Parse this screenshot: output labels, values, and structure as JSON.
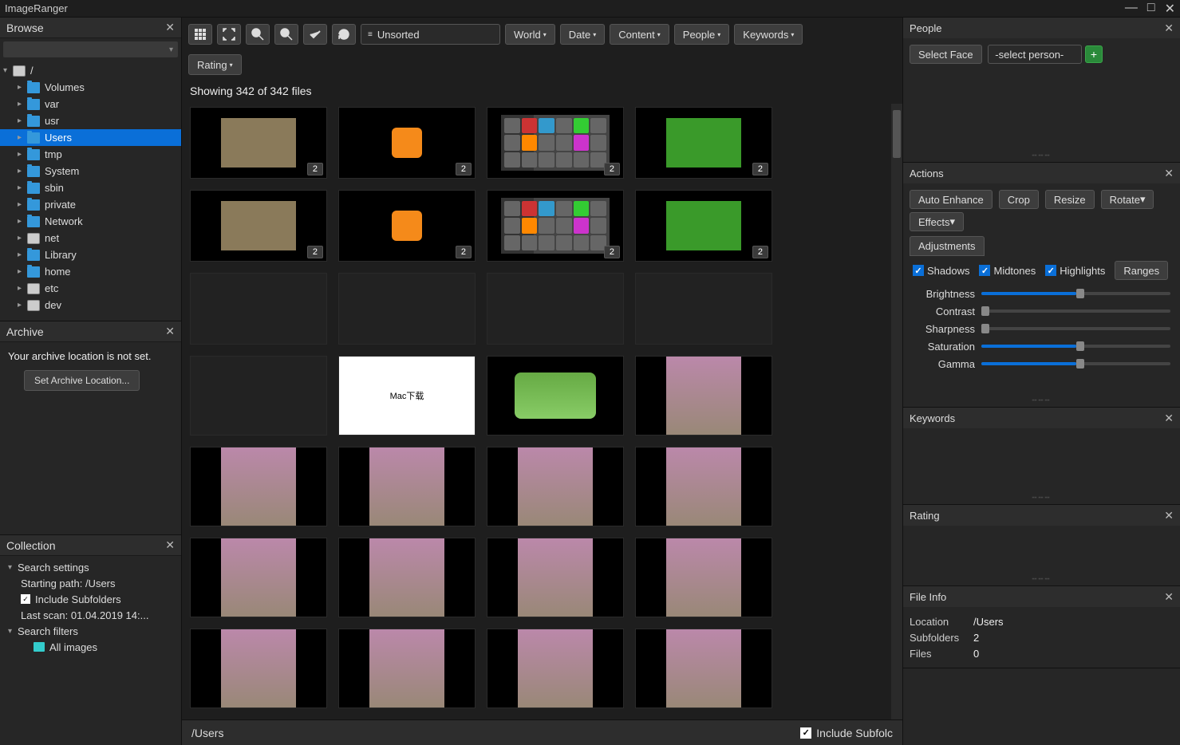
{
  "app": {
    "title": "ImageRanger"
  },
  "window_controls": {
    "min": "—",
    "max": "□",
    "close": "✕"
  },
  "left": {
    "browse": {
      "title": "Browse",
      "root": "/",
      "items": [
        "Volumes",
        "var",
        "usr",
        "Users",
        "tmp",
        "System",
        "sbin",
        "private",
        "Network",
        "net",
        "Library",
        "home",
        "etc",
        "dev"
      ],
      "selected": "Users",
      "disk_items": [
        "net",
        "etc",
        "dev"
      ]
    },
    "archive": {
      "title": "Archive",
      "message": "Your archive location is not set.",
      "button": "Set Archive Location..."
    },
    "collection": {
      "title": "Collection",
      "search_settings": "Search settings",
      "starting_path": "Starting path: /Users",
      "include_sub": "Include Subfolders",
      "last_scan": "Last scan: 01.04.2019 14:...",
      "search_filters": "Search filters",
      "all_images": "All images"
    }
  },
  "toolbar": {
    "sort_value": "Unsorted",
    "filters": [
      "World",
      "Date",
      "Content",
      "People",
      "Keywords"
    ],
    "rating": "Rating"
  },
  "main": {
    "showing": "Showing 342 of 342 files",
    "badge2": "2"
  },
  "status": {
    "path": "/Users",
    "include_subfolders": "Include Subfolc"
  },
  "right": {
    "people": {
      "title": "People",
      "select_face": "Select Face",
      "select_person": "-select person-"
    },
    "actions": {
      "title": "Actions",
      "auto_enhance": "Auto Enhance",
      "crop": "Crop",
      "resize": "Resize",
      "rotate": "Rotate",
      "effects": "Effects",
      "adjustments_tab": "Adjustments",
      "shadows": "Shadows",
      "midtones": "Midtones",
      "highlights": "Highlights",
      "ranges": "Ranges",
      "sliders": {
        "brightness": "Brightness",
        "contrast": "Contrast",
        "sharpness": "Sharpness",
        "saturation": "Saturation",
        "gamma": "Gamma"
      }
    },
    "keywords": {
      "title": "Keywords"
    },
    "rating": {
      "title": "Rating"
    },
    "fileinfo": {
      "title": "File Info",
      "location_k": "Location",
      "location_v": "/Users",
      "subfolders_k": "Subfolders",
      "subfolders_v": "2",
      "files_k": "Files",
      "files_v": "0"
    }
  }
}
